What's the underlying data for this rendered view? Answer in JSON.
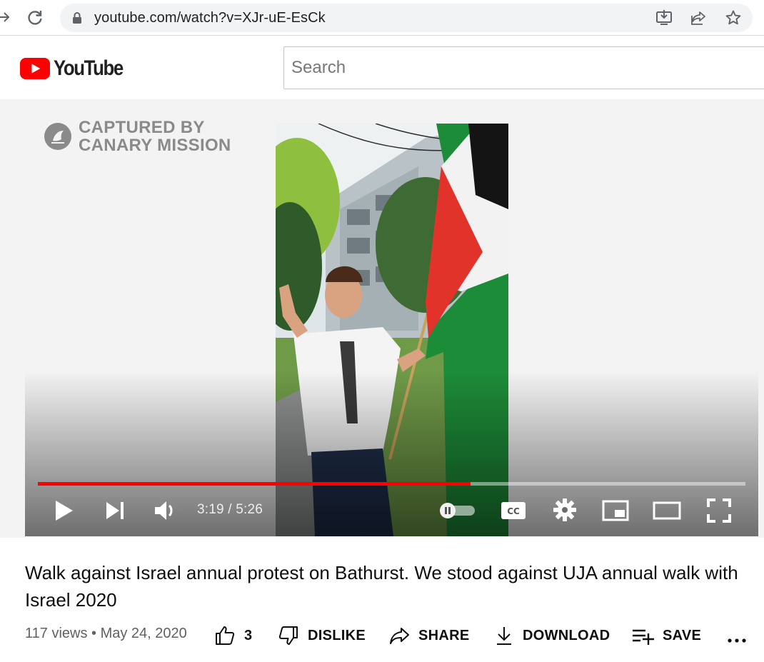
{
  "browser": {
    "url": "youtube.com/watch?v=XJr-uE-EsCk"
  },
  "header": {
    "logo_text": "YouTube",
    "search_placeholder": "Search"
  },
  "player": {
    "watermark_line1": "CAPTURED BY",
    "watermark_line2": "CANARY MISSION",
    "time": "3:19 / 5:26",
    "progress": 0.611,
    "colors": {
      "progress": "#ff0000",
      "logo_red": "#ff0000"
    }
  },
  "video": {
    "title": "Walk against Israel annual protest on Bathurst. We stood against UJA annual walk with Israel 2020",
    "views": "117 views",
    "date": "May 24, 2020",
    "likes": "3",
    "dislike_label": "DISLIKE",
    "share_label": "SHARE",
    "download_label": "DOWNLOAD",
    "save_label": "SAVE"
  },
  "icons": [
    "forward-icon",
    "reload-icon",
    "lock-icon",
    "install-icon",
    "share-page-icon",
    "bookmark-star-icon",
    "youtube-logo-icon",
    "canary-mission-icon",
    "play-icon",
    "next-icon",
    "volume-icon",
    "autoplay-toggle",
    "captions-icon",
    "settings-icon",
    "miniplayer-icon",
    "theater-icon",
    "fullscreen-icon",
    "like-icon",
    "dislike-icon",
    "share-icon",
    "download-icon",
    "save-icon",
    "more-icon"
  ]
}
